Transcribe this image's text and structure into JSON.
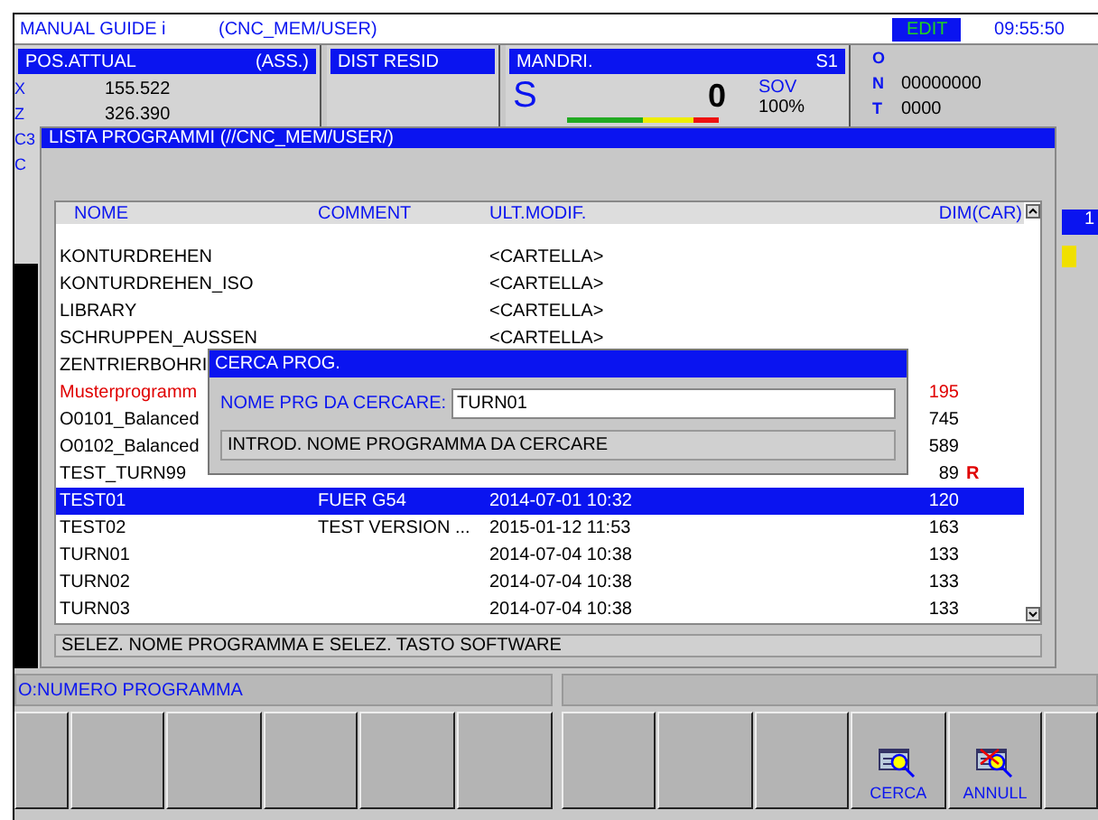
{
  "header": {
    "app": "MANUAL GUIDE i",
    "path": "(CNC_MEM/USER)",
    "mode": "EDIT",
    "time": "09:55:50"
  },
  "position": {
    "title": "POS.ATTUAL",
    "mode": "(ASS.)",
    "axes": [
      {
        "axis": "X",
        "value": "155.522"
      },
      {
        "axis": "Z",
        "value": "326.390"
      },
      {
        "axis": "C3"
      },
      {
        "axis": "C"
      }
    ]
  },
  "distance": {
    "title": "DIST RESID"
  },
  "spindle": {
    "title": "MANDRI.",
    "channel": "S1",
    "letter": "S",
    "speed": "0",
    "override_label": "SOV",
    "override": "100%"
  },
  "program": {
    "lines": [
      {
        "label": "O"
      },
      {
        "label": "N",
        "value": "00000000"
      },
      {
        "label": "T",
        "value": "0000"
      }
    ]
  },
  "side": {
    "page": "1"
  },
  "list_window": {
    "title": "LISTA PROGRAMMI (//CNC_MEM/USER/)",
    "columns": [
      "NOME",
      "COMMENT",
      "ULT.MODIF.",
      "DIM(CAR)"
    ],
    "rows": [
      {
        "name": "KONTURDREHEN",
        "modified": "<CARTELLA>",
        "selected": false,
        "flagged": false
      },
      {
        "name": "KONTURDREHEN_ISO",
        "modified": "<CARTELLA>",
        "selected": false,
        "flagged": false
      },
      {
        "name": "LIBRARY",
        "modified": "<CARTELLA>",
        "selected": false,
        "flagged": false
      },
      {
        "name": "SCHRUPPEN_AUSSEN",
        "modified": "<CARTELLA>",
        "selected": false,
        "flagged": false
      },
      {
        "name": "ZENTRIERBOHRI",
        "selected": false,
        "flagged": false
      },
      {
        "name": "Musterprogramm",
        "size": "195",
        "selected": false,
        "flagged": true
      },
      {
        "name": "O0101_Balanced",
        "size": "745",
        "selected": false,
        "flagged": false
      },
      {
        "name": "O0102_Balanced",
        "size": "589",
        "selected": false,
        "flagged": false
      },
      {
        "name": "TEST_TURN99",
        "size": "89",
        "flag": "R",
        "selected": false,
        "flagged": false
      },
      {
        "name": "TEST01",
        "comment": "FUER G54",
        "modified": "2014-07-01 10:32",
        "size": "120",
        "selected": true,
        "flagged": false
      },
      {
        "name": "TEST02",
        "comment": "TEST VERSION ...",
        "modified": "2015-01-12 11:53",
        "size": "163",
        "selected": false,
        "flagged": false
      },
      {
        "name": "TURN01",
        "modified": "2014-07-04 10:38",
        "size": "133",
        "selected": false,
        "flagged": false
      },
      {
        "name": "TURN02",
        "modified": "2014-07-04 10:38",
        "size": "133",
        "selected": false,
        "flagged": false
      },
      {
        "name": "TURN03",
        "modified": "2014-07-04 10:38",
        "size": "133",
        "selected": false,
        "flagged": false
      }
    ],
    "message": "SELEZ. NOME PROGRAMMA E SELEZ. TASTO SOFTWARE"
  },
  "search_dialog": {
    "title": "CERCA PROG.",
    "label": "NOME PRG DA CERCARE:",
    "value": "TURN01",
    "hint": "INTROD. NOME PROGRAMMA DA CERCARE"
  },
  "status": {
    "message": "O:NUMERO PROGRAMMA"
  },
  "softkeys": [
    {
      "kind": "blank",
      "partial": true
    },
    {
      "kind": "blank",
      "partial": false
    },
    {
      "kind": "blank",
      "partial": false
    },
    {
      "kind": "blank",
      "partial": false
    },
    {
      "kind": "blank",
      "partial": false
    },
    {
      "kind": "blank",
      "partial": false
    },
    {
      "kind": "blank",
      "partial": false
    },
    {
      "kind": "blank",
      "partial": false
    },
    {
      "kind": "blank",
      "partial": false
    },
    {
      "kind": "search",
      "label": "CERCA",
      "partial": false
    },
    {
      "kind": "cancel",
      "label": "ANNULL",
      "partial": false
    },
    {
      "kind": "blank",
      "partial": true
    }
  ]
}
